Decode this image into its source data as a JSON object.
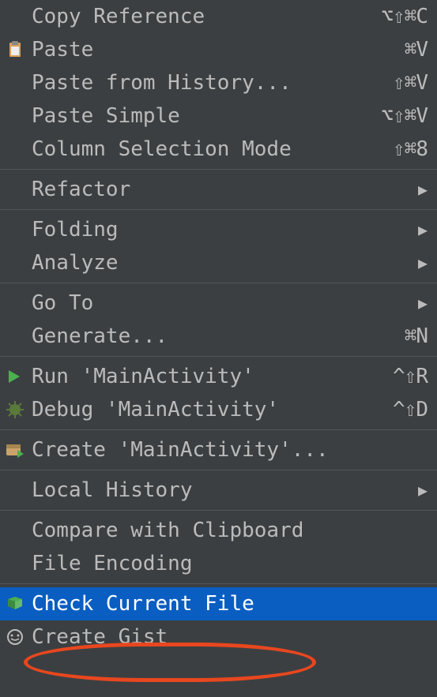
{
  "menu": {
    "items": [
      {
        "label": "Copy Reference",
        "shortcut": "⌥⇧⌘C",
        "icon": null,
        "submenu": false
      },
      {
        "label": "Paste",
        "shortcut": "⌘V",
        "icon": "paste",
        "submenu": false
      },
      {
        "label": "Paste from History...",
        "shortcut": "⇧⌘V",
        "icon": null,
        "submenu": false
      },
      {
        "label": "Paste Simple",
        "shortcut": "⌥⇧⌘V",
        "icon": null,
        "submenu": false
      },
      {
        "label": "Column Selection Mode",
        "shortcut": "⇧⌘8",
        "icon": null,
        "submenu": false
      },
      {
        "separator": true
      },
      {
        "label": "Refactor",
        "shortcut": "",
        "icon": null,
        "submenu": true
      },
      {
        "separator": true
      },
      {
        "label": "Folding",
        "shortcut": "",
        "icon": null,
        "submenu": true
      },
      {
        "label": "Analyze",
        "shortcut": "",
        "icon": null,
        "submenu": true
      },
      {
        "separator": true
      },
      {
        "label": "Go To",
        "shortcut": "",
        "icon": null,
        "submenu": true
      },
      {
        "label": "Generate...",
        "shortcut": "⌘N",
        "icon": null,
        "submenu": false
      },
      {
        "separator": true
      },
      {
        "label": "Run 'MainActivity'",
        "shortcut": "^⇧R",
        "icon": "run",
        "submenu": false
      },
      {
        "label": "Debug 'MainActivity'",
        "shortcut": "^⇧D",
        "icon": "debug",
        "submenu": false
      },
      {
        "separator": true
      },
      {
        "label": "Create 'MainActivity'...",
        "shortcut": "",
        "icon": "create-run",
        "submenu": false
      },
      {
        "separator": true
      },
      {
        "label": "Local History",
        "shortcut": "",
        "icon": null,
        "submenu": true
      },
      {
        "separator": true
      },
      {
        "label": "Compare with Clipboard",
        "shortcut": "",
        "icon": null,
        "submenu": false
      },
      {
        "label": "File Encoding",
        "shortcut": "",
        "icon": null,
        "submenu": false
      },
      {
        "separator": true
      },
      {
        "label": "Check Current File",
        "shortcut": "",
        "icon": "check",
        "submenu": false,
        "highlighted": true
      },
      {
        "label": "Create Gist",
        "shortcut": "",
        "icon": "gist",
        "submenu": false
      }
    ]
  },
  "colors": {
    "bg": "#3c3f41",
    "text": "#bbbbbb",
    "highlight_bg": "#0a5ec1",
    "annotation": "#e8471f"
  }
}
